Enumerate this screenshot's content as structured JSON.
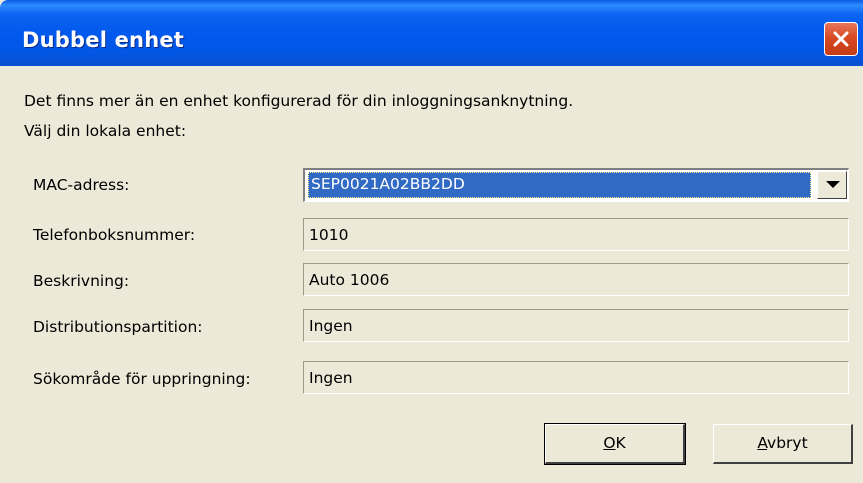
{
  "window": {
    "title": "Dubbel enhet",
    "close_icon": "close-icon",
    "titlebar_color": "#0058ee"
  },
  "message": {
    "line1": "Det finns mer än en enhet konfigurerad för din inloggningsanknytning.",
    "line2": "Välj din lokala enhet:"
  },
  "form": {
    "mac": {
      "label": "MAC-adress:",
      "value": "SEP0021A02BB2DD",
      "icon": "dropdown-arrow-icon"
    },
    "phone": {
      "label": "Telefonboksnummer:",
      "value": "1010"
    },
    "description": {
      "label": "Beskrivning:",
      "value": "Auto 1006"
    },
    "distribution": {
      "label": "Distributionspartition:",
      "value": "Ingen"
    },
    "search": {
      "label": "Sökområde för uppringning:",
      "value": "Ingen"
    }
  },
  "buttons": {
    "ok": {
      "accel": "O",
      "rest": "K"
    },
    "cancel": {
      "accel": "A",
      "rest": "vbryt"
    }
  },
  "colors": {
    "selection": "#316ac5",
    "dialog_bg": "#ece9d8",
    "close_red": "#d84a23"
  }
}
